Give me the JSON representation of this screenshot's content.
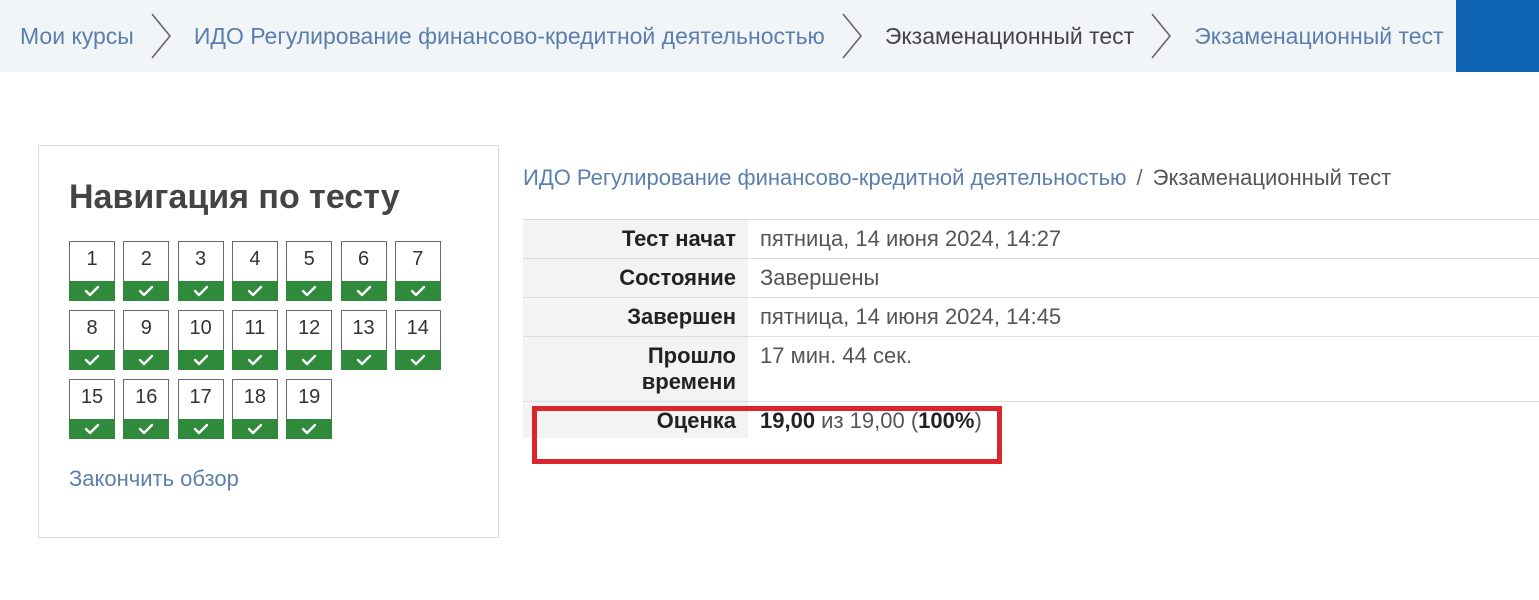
{
  "breadcrumb": {
    "items": [
      {
        "label": "Мои курсы",
        "type": "link"
      },
      {
        "label": "ИДО Регулирование финансово-кредитной деятельностью",
        "type": "link"
      },
      {
        "label": "Экзаменационный тест",
        "type": "current"
      },
      {
        "label": "Экзаменационный тест",
        "type": "link"
      }
    ]
  },
  "nav": {
    "title": "Навигация по тесту",
    "questions": [
      "1",
      "2",
      "3",
      "4",
      "5",
      "6",
      "7",
      "8",
      "9",
      "10",
      "11",
      "12",
      "13",
      "14",
      "15",
      "16",
      "17",
      "18",
      "19"
    ],
    "finish_label": "Закончить обзор",
    "status_icon": "check-icon",
    "correct_color": "#2f8a3b"
  },
  "summary": {
    "course_link": "ИДО Регулирование финансово-кредитной деятельностью",
    "separator": "/",
    "test_name": "Экзаменационный тест",
    "rows": {
      "started_key": "Тест начат",
      "started_val": "пятница, 14 июня 2024, 14:27",
      "state_key": "Состояние",
      "state_val": "Завершены",
      "finished_key": "Завершен",
      "finished_val": "пятница, 14 июня 2024, 14:45",
      "elapsed_key_line1": "Прошло",
      "elapsed_key_line2": "времени",
      "elapsed_val": "17 мин. 44 сек.",
      "grade_key": "Оценка",
      "grade_score": "19,00",
      "grade_mid": " из 19,00 (",
      "grade_percent": "100%",
      "grade_end": ")"
    }
  },
  "colors": {
    "accent_blue": "#0f63b3",
    "link": "#5b7fad",
    "highlight": "#d9262c"
  }
}
